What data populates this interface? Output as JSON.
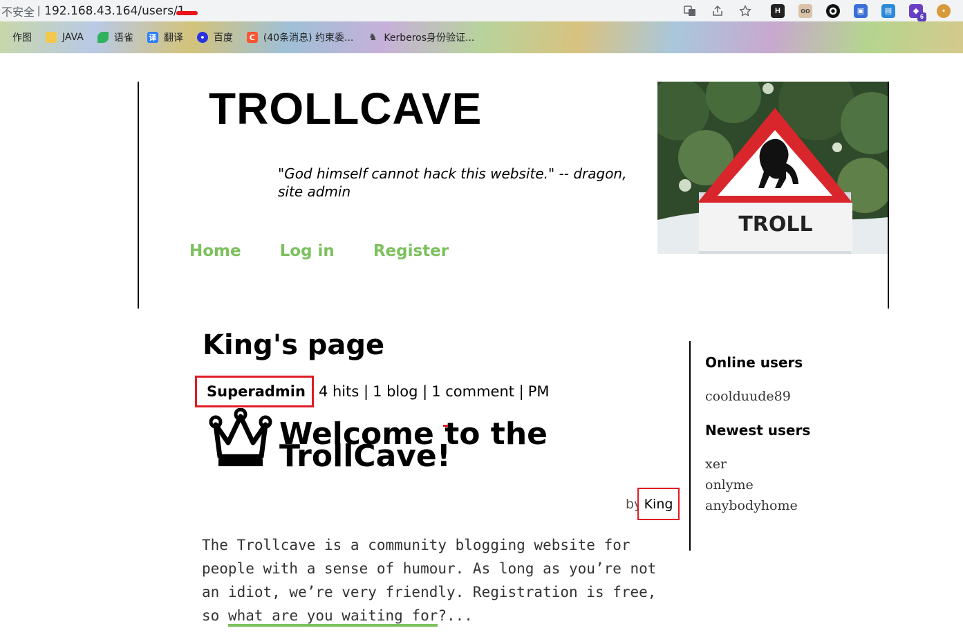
{
  "browser": {
    "security_label": "不安全",
    "url": "192.168.43.164/users/1",
    "bookmarks": [
      {
        "label": "作图",
        "icon": "folder-icon",
        "color": "#f2c94c"
      },
      {
        "label": "JAVA",
        "icon": "folder-icon",
        "color": "#f2c94c"
      },
      {
        "label": "语雀",
        "icon": "yuque-icon",
        "color": "#2fb15e"
      },
      {
        "label": "翻译",
        "icon": "translate-icon",
        "color": "#2d7ff9"
      },
      {
        "label": "百度",
        "icon": "baidu-icon",
        "color": "#2932e1"
      },
      {
        "label": "(40条消息) 约束委...",
        "icon": "csdn-icon",
        "color": "#fc5531"
      },
      {
        "label": "Kerberos身份验证...",
        "icon": "kerberos-icon",
        "color": "#555555"
      }
    ]
  },
  "site": {
    "title": "TROLLCAVE",
    "tagline": "\"God himself cannot hack this website.\" -- dragon, site admin",
    "nav": [
      "Home",
      "Log in",
      "Register"
    ],
    "header_sign_text": "TROLL",
    "accent_color": "#7cc15d"
  },
  "user_page": {
    "title": "King's page",
    "rank": "Superadmin",
    "hits": "4 hits |",
    "blogs": "1 blog |",
    "comments": "1 comment |",
    "pm": "PM"
  },
  "post": {
    "icon": "crown-icon",
    "title": "Welcome to the TrollCave!",
    "by": "by",
    "author": "King",
    "excerpt": "The Trollcave is a community blogging website for people with a sense of humour. As long as you’re not an idiot, we’re very friendly. Registration is free, so ",
    "readmore": "what are you waiting for",
    "ellipsis": "?..."
  },
  "sidebar": {
    "online_heading": "Online users",
    "online_users": [
      "coolduude89"
    ],
    "newest_heading": "Newest users",
    "newest_users": [
      "xer",
      "onlyme",
      "anybodyhome"
    ]
  }
}
